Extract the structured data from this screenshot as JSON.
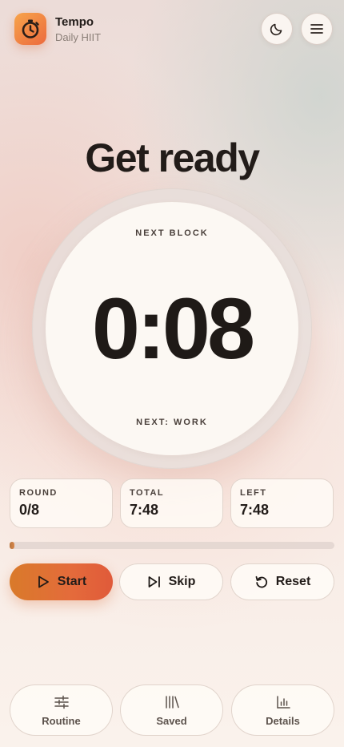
{
  "app": {
    "name": "Tempo",
    "subtitle": "Daily HIIT",
    "icon": "stopwatch-icon",
    "brand_color": "#EE7A3F"
  },
  "header": {
    "theme_toggle_icon": "moon-icon",
    "menu_icon": "hamburger-menu-icon"
  },
  "status": {
    "title": "Get ready"
  },
  "timer": {
    "top_label": "NEXT BLOCK",
    "time": "0:08",
    "bottom_label": "NEXT: WORK"
  },
  "stats": [
    {
      "label": "ROUND",
      "value": "0/8"
    },
    {
      "label": "TOTAL",
      "value": "7:48"
    },
    {
      "label": "LEFT",
      "value": "7:48"
    }
  ],
  "progress": {
    "fraction": 0.0
  },
  "controls": {
    "start_label": "Start",
    "start_icon": "play-icon",
    "skip_label": "Skip",
    "skip_icon": "skip-next-icon",
    "reset_label": "Reset",
    "reset_icon": "reset-icon"
  },
  "nav": [
    {
      "label": "Routine",
      "icon": "sliders-icon"
    },
    {
      "label": "Saved",
      "icon": "library-icon"
    },
    {
      "label": "Details",
      "icon": "bar-chart-icon"
    }
  ]
}
